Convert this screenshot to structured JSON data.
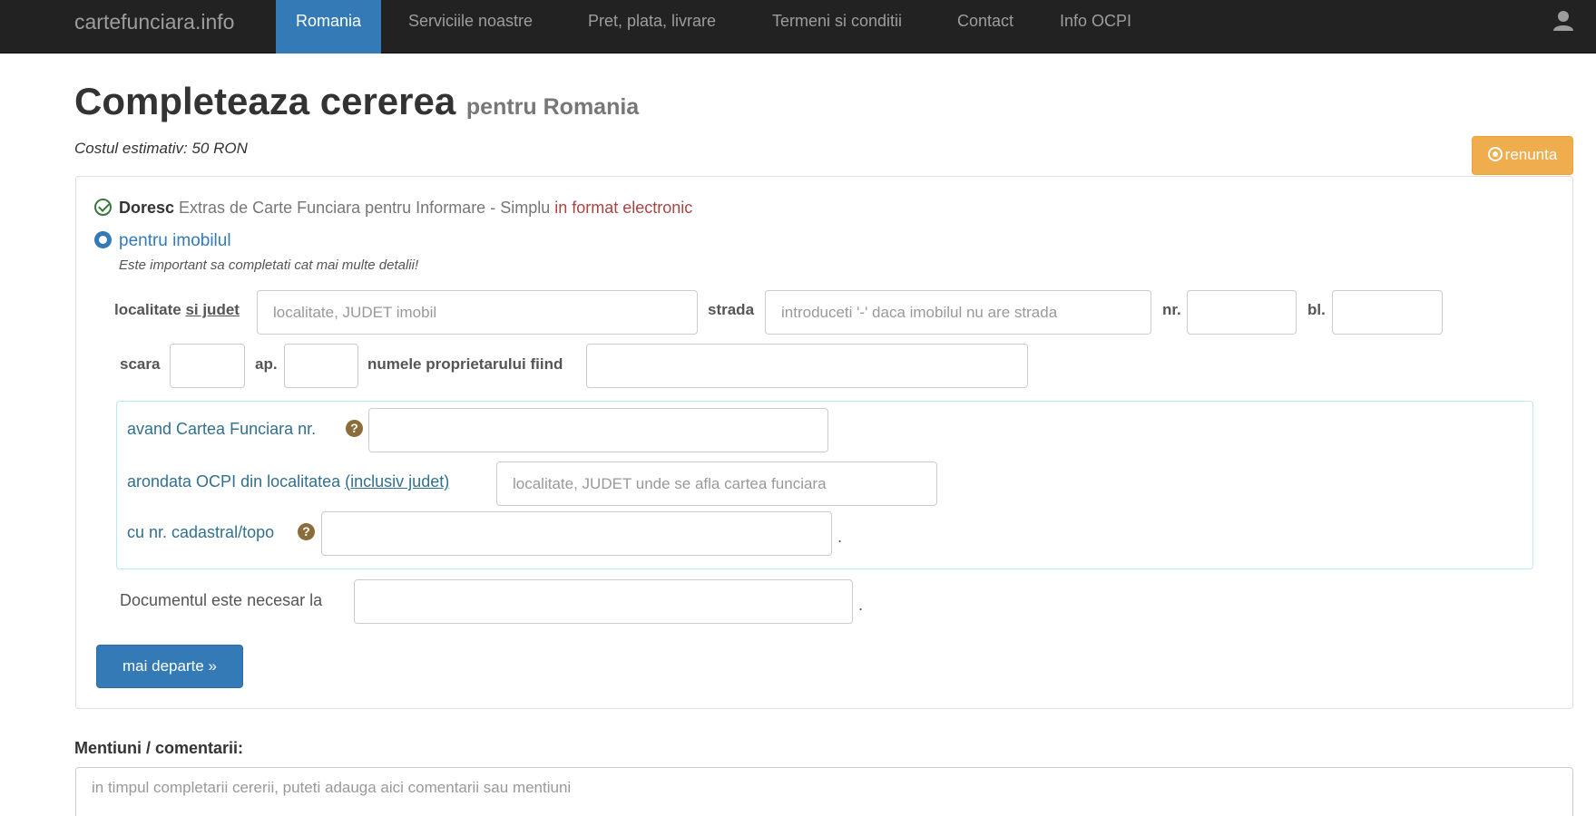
{
  "navbar": {
    "brand": "cartefunciara.info",
    "items": [
      {
        "label": "Romania",
        "active": true
      },
      {
        "label": "Serviciile noastre"
      },
      {
        "label": "Pret, plata, livrare"
      },
      {
        "label": "Termeni si conditii"
      },
      {
        "label": "Contact"
      },
      {
        "label": "Info OCPI"
      }
    ],
    "user_icon": "user-icon"
  },
  "header": {
    "title": "Completeaza cererea",
    "subtitle": "pentru Romania",
    "cost_label": "Costul estimativ:",
    "cost_value": "50 RON",
    "cancel_label": "renunta"
  },
  "form": {
    "request_prefix": "Doresc",
    "request_text": "Extras de Carte Funciara pentru Informare - Simplu",
    "request_format": "in format electronic",
    "property_label": "pentru imobilul",
    "hint": "Este important sa completati cat mai multe detalii!",
    "locality_label_a": "localitate",
    "locality_label_b": "si judet",
    "locality_placeholder": "localitate, JUDET imobil",
    "street_label": "strada",
    "street_placeholder": "introduceti '-' daca imobilul nu are strada",
    "nr_label": "nr.",
    "bl_label": "bl.",
    "stair_label": "scara",
    "ap_label": "ap.",
    "owner_label": "numele proprietarului fiind",
    "cf_label": "avand Cartea Funciara nr.",
    "ocpi_label_a": "arondata OCPI din localitatea",
    "ocpi_label_b": "(inclusiv judet)",
    "ocpi_placeholder": "localitate, JUDET unde se afla cartea funciara",
    "cadastral_label": "cu nr. cadastral/topo",
    "purpose_label": "Documentul este necesar la",
    "next_button": "mai departe »"
  },
  "comments": {
    "label": "Mentiuni / comentarii:",
    "placeholder": "in timpul completarii cererii, puteti adauga aici comentarii sau mentiuni"
  }
}
